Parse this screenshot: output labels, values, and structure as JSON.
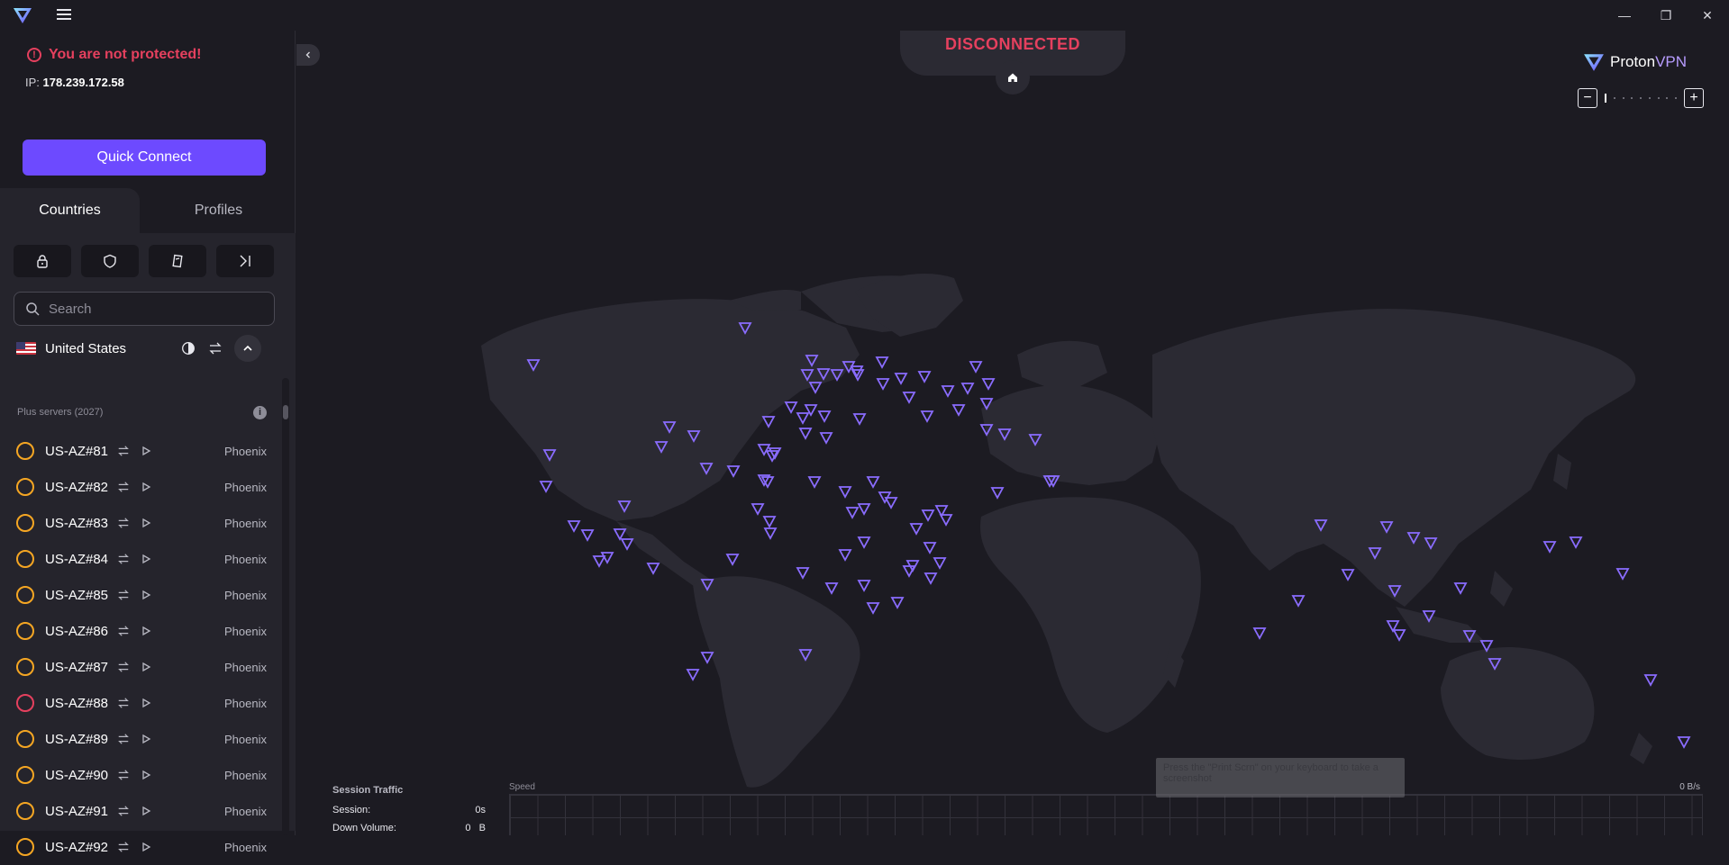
{
  "window": {
    "minimize_glyph": "—",
    "restore_glyph": "❐",
    "close_glyph": "✕"
  },
  "status": {
    "warning": "You are not protected!",
    "ip_label": "IP:",
    "ip_value": "178.239.172.58",
    "connection": "DISCONNECTED"
  },
  "sidebar": {
    "quick_connect": "Quick Connect",
    "tabs": [
      "Countries",
      "Profiles"
    ],
    "filters": [
      "lock-icon",
      "shield-icon",
      "card-icon",
      "arrow-bar-icon"
    ],
    "search_placeholder": "Search",
    "country": {
      "name": "United States",
      "group_header": "Plus servers (2027)",
      "servers": [
        {
          "name": "US-AZ#81",
          "city": "Phoenix",
          "load": "medium"
        },
        {
          "name": "US-AZ#82",
          "city": "Phoenix",
          "load": "medium"
        },
        {
          "name": "US-AZ#83",
          "city": "Phoenix",
          "load": "medium"
        },
        {
          "name": "US-AZ#84",
          "city": "Phoenix",
          "load": "medium"
        },
        {
          "name": "US-AZ#85",
          "city": "Phoenix",
          "load": "medium"
        },
        {
          "name": "US-AZ#86",
          "city": "Phoenix",
          "load": "medium"
        },
        {
          "name": "US-AZ#87",
          "city": "Phoenix",
          "load": "medium"
        },
        {
          "name": "US-AZ#88",
          "city": "Phoenix",
          "load": "high"
        },
        {
          "name": "US-AZ#89",
          "city": "Phoenix",
          "load": "medium"
        },
        {
          "name": "US-AZ#90",
          "city": "Phoenix",
          "load": "medium"
        },
        {
          "name": "US-AZ#91",
          "city": "Phoenix",
          "load": "medium"
        },
        {
          "name": "US-AZ#92",
          "city": "Phoenix",
          "load": "medium"
        }
      ]
    }
  },
  "brand": {
    "proton": "Proton",
    "vpn": "VPN"
  },
  "traffic": {
    "title": "Session Traffic",
    "session_label": "Session:",
    "session_value": "0s",
    "down_label": "Down Volume:",
    "down_value": "0",
    "down_unit": "B",
    "speed_label": "Speed",
    "speed_value": "0  B/s"
  },
  "tooltip": "Press the \"Print Scrn\" on your keyboard to take a screenshot",
  "colors": {
    "accent": "#6d4aff",
    "danger": "#e5405e",
    "load_medium": "#f5a623",
    "map_land": "#2b2a33",
    "marker": "#8a6cff"
  }
}
